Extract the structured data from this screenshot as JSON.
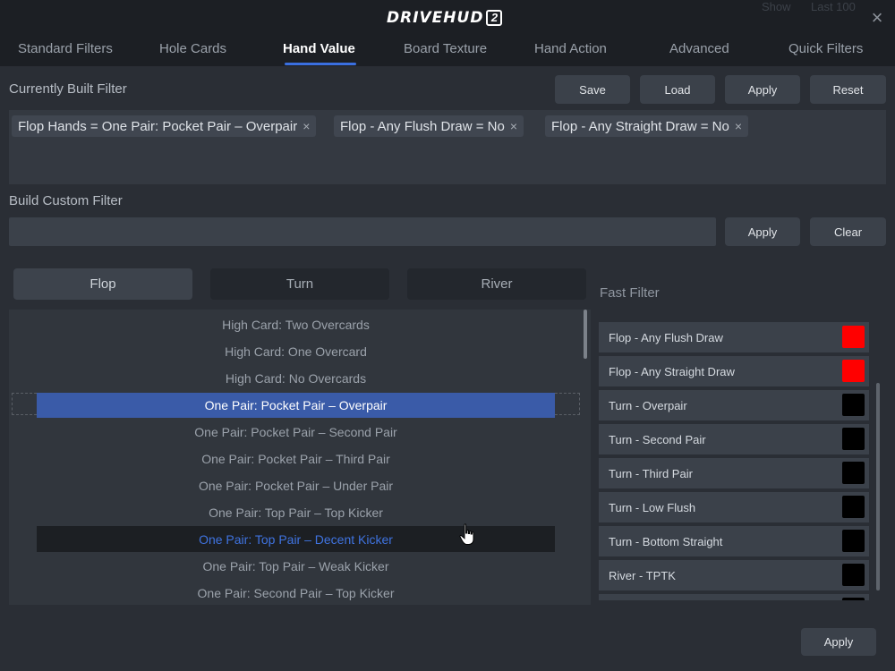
{
  "app": {
    "logo_text": "DRIVEHUD",
    "logo_badge": "2",
    "background_show": "Show",
    "background_last": "Last 100"
  },
  "tabs": [
    {
      "label": "Standard Filters"
    },
    {
      "label": "Hole Cards"
    },
    {
      "label": "Hand Value"
    },
    {
      "label": "Board Texture"
    },
    {
      "label": "Hand Action"
    },
    {
      "label": "Advanced"
    },
    {
      "label": "Quick Filters"
    }
  ],
  "active_tab": "Hand Value",
  "built_filter": {
    "title": "Currently Built Filter",
    "buttons": {
      "save": "Save",
      "load": "Load",
      "apply": "Apply",
      "reset": "Reset"
    },
    "chips": [
      {
        "label": "Flop Hands = One Pair: Pocket Pair – Overpair"
      },
      {
        "label": "Flop  -  Any Flush Draw = No"
      },
      {
        "label": "Flop  -  Any Straight Draw = No"
      }
    ],
    "chip_close": "×"
  },
  "custom_filter": {
    "title": "Build Custom Filter",
    "input_value": "",
    "apply_label": "Apply",
    "clear_label": "Clear"
  },
  "streets": [
    {
      "label": "Flop"
    },
    {
      "label": "Turn"
    },
    {
      "label": "River"
    }
  ],
  "active_street": "Flop",
  "hand_list": [
    {
      "label": "High Card: Two Overcards"
    },
    {
      "label": "High Card: One Overcard"
    },
    {
      "label": "High Card: No Overcards"
    },
    {
      "label": "One Pair: Pocket Pair – Overpair",
      "state": "selected"
    },
    {
      "label": "One Pair: Pocket Pair – Second Pair"
    },
    {
      "label": "One Pair: Pocket Pair – Third Pair"
    },
    {
      "label": "One Pair: Pocket Pair – Under Pair"
    },
    {
      "label": "One Pair: Top Pair – Top Kicker"
    },
    {
      "label": "One Pair: Top Pair – Decent Kicker",
      "state": "hovered"
    },
    {
      "label": "One Pair: Top Pair – Weak Kicker"
    },
    {
      "label": "One Pair: Second Pair – Top Kicker"
    }
  ],
  "fast_filter": {
    "title": "Fast Filter",
    "items": [
      {
        "label": "Flop  -  Any Flush Draw",
        "color": "#ff0000"
      },
      {
        "label": "Flop  -  Any Straight Draw",
        "color": "#ff0000"
      },
      {
        "label": "Turn  -  Overpair",
        "color": "#000000"
      },
      {
        "label": "Turn  -  Second Pair",
        "color": "#000000"
      },
      {
        "label": "Turn  -  Third Pair",
        "color": "#000000"
      },
      {
        "label": "Turn  -  Low Flush",
        "color": "#000000"
      },
      {
        "label": "Turn  -  Bottom Straight",
        "color": "#000000"
      },
      {
        "label": "River  -  TPTK",
        "color": "#000000"
      },
      {
        "label": "",
        "color": "#000000"
      }
    ]
  },
  "footer": {
    "apply_label": "Apply"
  },
  "icons": {
    "close": "close-icon",
    "cursor": "hand-pointer-icon"
  }
}
